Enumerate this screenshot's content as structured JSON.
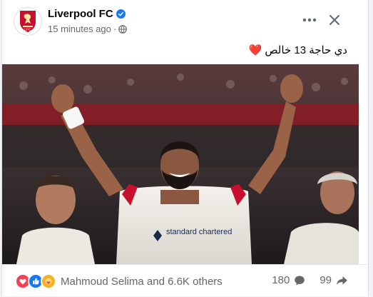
{
  "post": {
    "page_name": "Liverpool FC",
    "verified_icon": "verified-badge-icon",
    "timestamp": "15 minutes ago",
    "audience_icon": "globe-icon",
    "more_icon": "more-horizontal-icon",
    "close_icon": "close-icon",
    "caption": "دي حاجة 13 خالص ❤️",
    "photo_description": "Player in white kit celebrating with arms raised",
    "sponsor_text": "standard chartered"
  },
  "footer": {
    "reaction_icons": [
      "love-icon",
      "like-icon",
      "care-icon"
    ],
    "reactions_text": "Mahmoud Selima and 6.6K others",
    "comments_count": "180",
    "shares_count": "99",
    "comment_icon": "comment-icon",
    "share_icon": "share-icon"
  },
  "colors": {
    "brand_blue": "#1877f2",
    "liverpool_red": "#c8102e",
    "text_primary": "#050505",
    "text_secondary": "#65676b"
  }
}
